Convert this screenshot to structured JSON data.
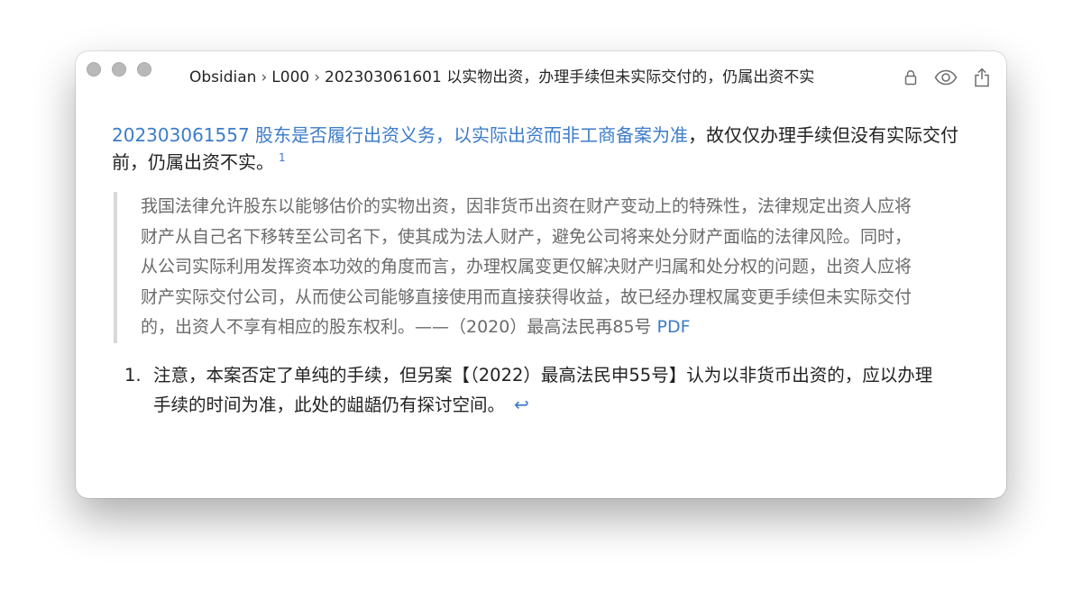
{
  "window": {
    "breadcrumb": [
      "Obsidian",
      "L000",
      "202303061601 以实物出资，办理手续但未实际交付的，仍属出资不实"
    ],
    "breadcrumb_separator": "›"
  },
  "toolbar": {
    "lock_icon": "lock-icon",
    "reading_view_icon": "eye-icon",
    "share_icon": "share-icon"
  },
  "note": {
    "link_text": "202303061557 股东是否履行出资义务，以实际出资而非工商备案为准",
    "after_link": "，故仅仅办理手续但没有实际交付前，仍属出资不实。",
    "footnote_ref": "1",
    "quote_text": "我国法律允许股东以能够估价的实物出资，因非货币出资在财产变动上的特殊性，法律规定出资人应将财产从自己名下移转至公司名下，使其成为法人财产，避免公司将来处分财产面临的法律风险。同时，从公司实际利用发挥资本功效的角度而言，办理权属变更仅解决财产归属和处分权的问题，出资人应将财产实际交付公司，从而使公司能够直接使用而直接获得收益，故已经办理权属变更手续但未实际交付的，出资人不享有相应的股东权利。——（2020）最高法民再85号",
    "pdf_link": "PDF"
  },
  "footnotes": [
    {
      "number": "1.",
      "text": "注意，本案否定了单纯的手续，但另案【（2022）最高法民申55号】认为以非货币出资的，应以办理手续的时间为准，此处的龃龉仍有探讨空间。",
      "backref": "↩"
    }
  ],
  "colors": {
    "link": "#3d7cc9",
    "quote_text": "#6b6b6b",
    "quote_border": "#d9d9d9",
    "traffic_light": "#b9b9b9"
  }
}
